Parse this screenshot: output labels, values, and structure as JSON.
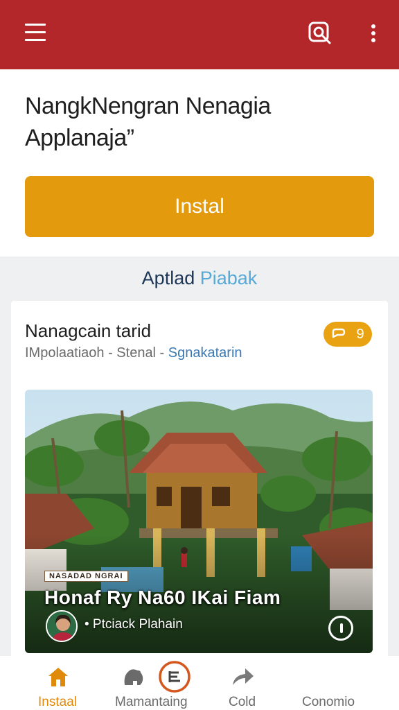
{
  "app": {
    "colors": {
      "brand": "#b3262a",
      "accent": "#e39a0d",
      "link": "#57a9d6"
    },
    "icons": {
      "menu": "menu-icon",
      "scan": "scan-search-icon",
      "more": "more-vertical-icon"
    }
  },
  "hero": {
    "title_line1": "NangkNengran Nenagia",
    "title_line2": "Applanaja”",
    "install_label": "Instal"
  },
  "section": {
    "heading_dark": "Aptlad",
    "heading_light": "Piabak"
  },
  "card": {
    "title": "Nanagcain tarid",
    "subtitle_main": "IMpolaatiaoh - Stenal - ",
    "subtitle_accent": "Sgnakatarin",
    "badge_count": "9",
    "photo": {
      "tag": "NASADAD NGRAI",
      "title": "Honaf Ry Na60 IKai Fiam",
      "author": "• Ptciack Plahain"
    }
  },
  "bottom_nav": {
    "items": [
      {
        "label": "Instaal",
        "icon": "home-icon",
        "active": true
      },
      {
        "label": "Mamantaing",
        "icon": "bear-icon",
        "active": false
      },
      {
        "label": "",
        "icon": "list-circle-icon",
        "active": false
      },
      {
        "label": "Cold",
        "icon": "share-arrow-icon",
        "active": false
      },
      {
        "label": "Conomio",
        "icon": "",
        "active": false
      }
    ]
  }
}
